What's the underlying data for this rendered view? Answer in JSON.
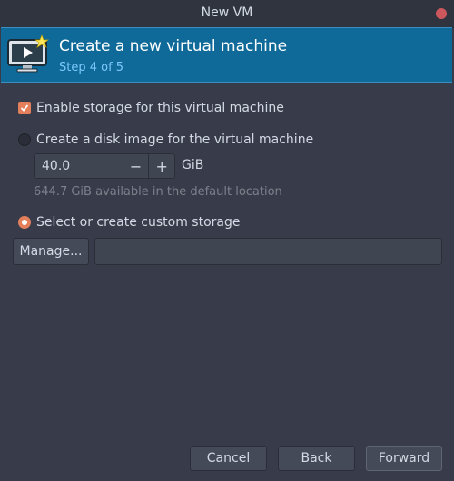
{
  "window": {
    "title": "New VM"
  },
  "banner": {
    "title": "Create a new virtual machine",
    "step": "Step 4 of 5"
  },
  "options": {
    "enable_storage": {
      "label": "Enable storage for this virtual machine",
      "checked": true
    },
    "disk_image": {
      "label": "Create a disk image for the virtual machine",
      "selected": false
    },
    "custom_storage": {
      "label": "Select or create custom storage",
      "selected": true
    }
  },
  "disk": {
    "size_value": "40.0",
    "decrement_glyph": "−",
    "increment_glyph": "+",
    "unit": "GiB",
    "available_text": "644.7 GiB available in the default location"
  },
  "custom": {
    "manage_label": "Manage...",
    "path_value": ""
  },
  "footer": {
    "cancel_label": "Cancel",
    "back_label": "Back",
    "forward_label": "Forward"
  },
  "colors": {
    "accent": "#e3805b",
    "banner": "#0f6a9a",
    "background": "#383c4a",
    "close": "#cc575d"
  },
  "icons": {
    "banner": "monitor-play-icon",
    "close": "close-icon",
    "check": "check-icon"
  }
}
